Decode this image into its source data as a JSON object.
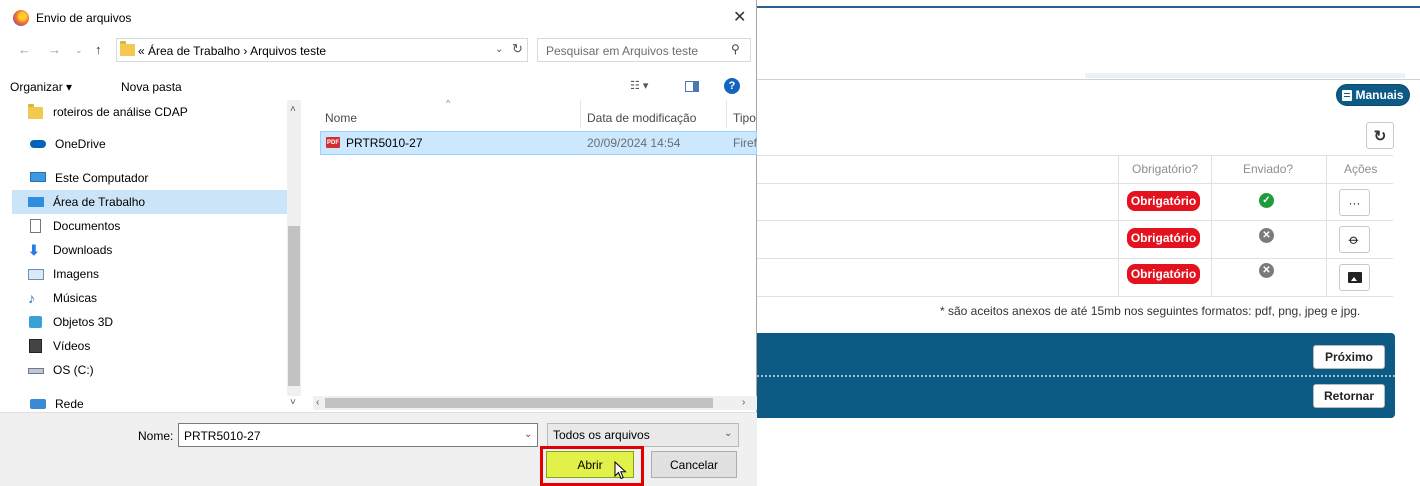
{
  "background": {
    "manuais_label": "Manuais",
    "table_headers": [
      "Obrigatório?",
      "Enviado?",
      "Ações"
    ],
    "rows": [
      {
        "badge": "Obrigatório",
        "status": "sent",
        "action_icon": "ellipsis-icon"
      },
      {
        "badge": "Obrigatório",
        "status": "not-sent",
        "action_icon": "paperclip-icon"
      },
      {
        "badge": "Obrigatório",
        "status": "not-sent",
        "action_icon": "image-icon"
      }
    ],
    "note": "* são aceitos anexos de até 15mb nos seguintes formatos: pdf, png, jpeg e jpg.",
    "next_label": "Próximo",
    "back_label": "Retornar",
    "colors": {
      "brand": "#0d5a85",
      "badge": "#e3121e",
      "sent": "#1e9b3a",
      "not_sent": "#7b7b7b"
    }
  },
  "dialog": {
    "title": "Envio de arquivos",
    "address": {
      "path_text": "«  Área de Trabalho  ›  Arquivos teste"
    },
    "search_placeholder": "Pesquisar em Arquivos teste",
    "toolbar": {
      "organize": "Organizar ▾",
      "new_folder": "Nova pasta"
    },
    "nav_items": [
      {
        "label": "roteiros de análise CDAP",
        "icon": "folder-icon"
      },
      {
        "label": "OneDrive",
        "icon": "cloud-icon"
      },
      {
        "label": "Este Computador",
        "icon": "computer-icon"
      },
      {
        "label": "Área de Trabalho",
        "icon": "desktop-icon",
        "selected": true
      },
      {
        "label": "Documentos",
        "icon": "document-icon"
      },
      {
        "label": "Downloads",
        "icon": "download-icon"
      },
      {
        "label": "Imagens",
        "icon": "pictures-icon"
      },
      {
        "label": "Músicas",
        "icon": "music-icon"
      },
      {
        "label": "Objetos 3D",
        "icon": "cube-icon"
      },
      {
        "label": "Vídeos",
        "icon": "video-icon"
      },
      {
        "label": "OS (C:)",
        "icon": "drive-icon"
      },
      {
        "label": "Rede",
        "icon": "network-icon"
      }
    ],
    "columns": {
      "name": "Nome",
      "modified": "Data de modificação",
      "type": "Tipo"
    },
    "files": [
      {
        "name": "PRTR5010-27",
        "modified": "20/09/2024 14:54",
        "type": "Firef"
      }
    ],
    "filename_label": "Nome:",
    "filename_value": "PRTR5010-27",
    "filetype_value": "Todos os arquivos",
    "open_label": "Abrir",
    "cancel_label": "Cancelar"
  }
}
